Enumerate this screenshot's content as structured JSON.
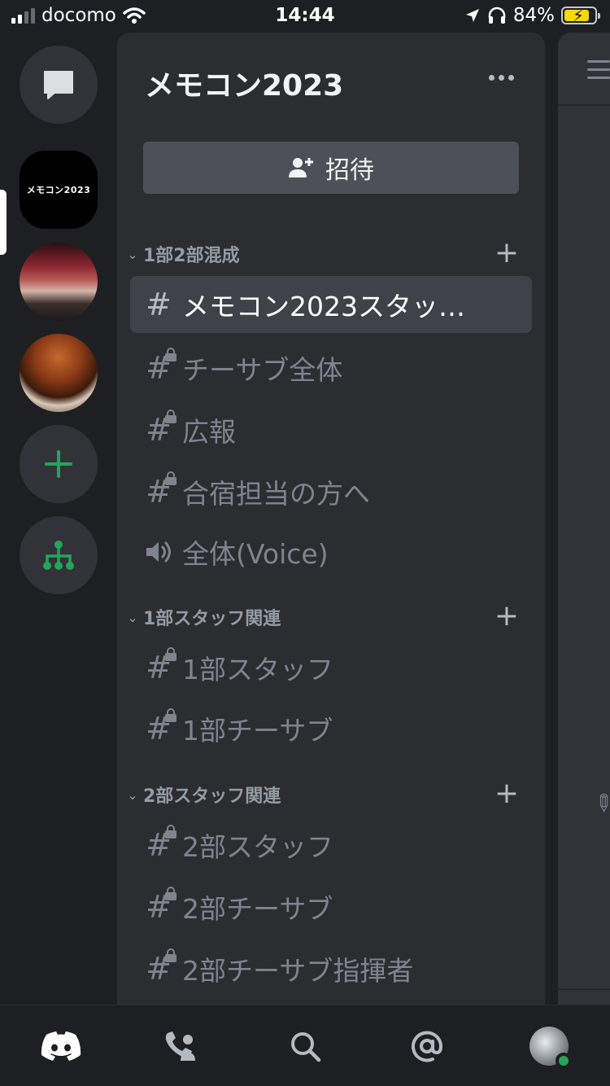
{
  "status_bar": {
    "carrier": "docomo",
    "time": "14:44",
    "battery": "84%",
    "battery_level": 0.84
  },
  "rail": {
    "servers": [
      {
        "name": "メモコン2023",
        "label": "メモコン2023",
        "selected": true
      },
      {
        "name": "server-photo-1"
      },
      {
        "name": "server-photo-2"
      }
    ]
  },
  "server": {
    "title": "メモコン2023",
    "invite_label": "招待"
  },
  "categories": [
    {
      "label": "1部2部混成",
      "channels": [
        {
          "label": "メモコン2023スタッ…",
          "type": "text",
          "locked": false,
          "selected": true
        },
        {
          "label": "チーサブ全体",
          "type": "text",
          "locked": true
        },
        {
          "label": "広報",
          "type": "text",
          "locked": true
        },
        {
          "label": "合宿担当の方へ",
          "type": "text",
          "locked": true
        },
        {
          "label": "全体(Voice)",
          "type": "voice",
          "locked": false
        }
      ]
    },
    {
      "label": "1部スタッフ関連",
      "channels": [
        {
          "label": "1部スタッフ",
          "type": "text",
          "locked": true
        },
        {
          "label": "1部チーサブ",
          "type": "text",
          "locked": true
        }
      ]
    },
    {
      "label": "2部スタッフ関連",
      "channels": [
        {
          "label": "2部スタッフ",
          "type": "text",
          "locked": true
        },
        {
          "label": "2部チーサブ",
          "type": "text",
          "locked": true
        },
        {
          "label": "2部チーサブ指揮者",
          "type": "text",
          "locked": true
        }
      ]
    }
  ],
  "colors": {
    "accent_green": "#23a55a",
    "panel": "#2b2d31",
    "selected": "#404249"
  },
  "bottom_nav": [
    "home-icon",
    "friends-icon",
    "search-icon",
    "mentions-icon",
    "profile-avatar"
  ]
}
